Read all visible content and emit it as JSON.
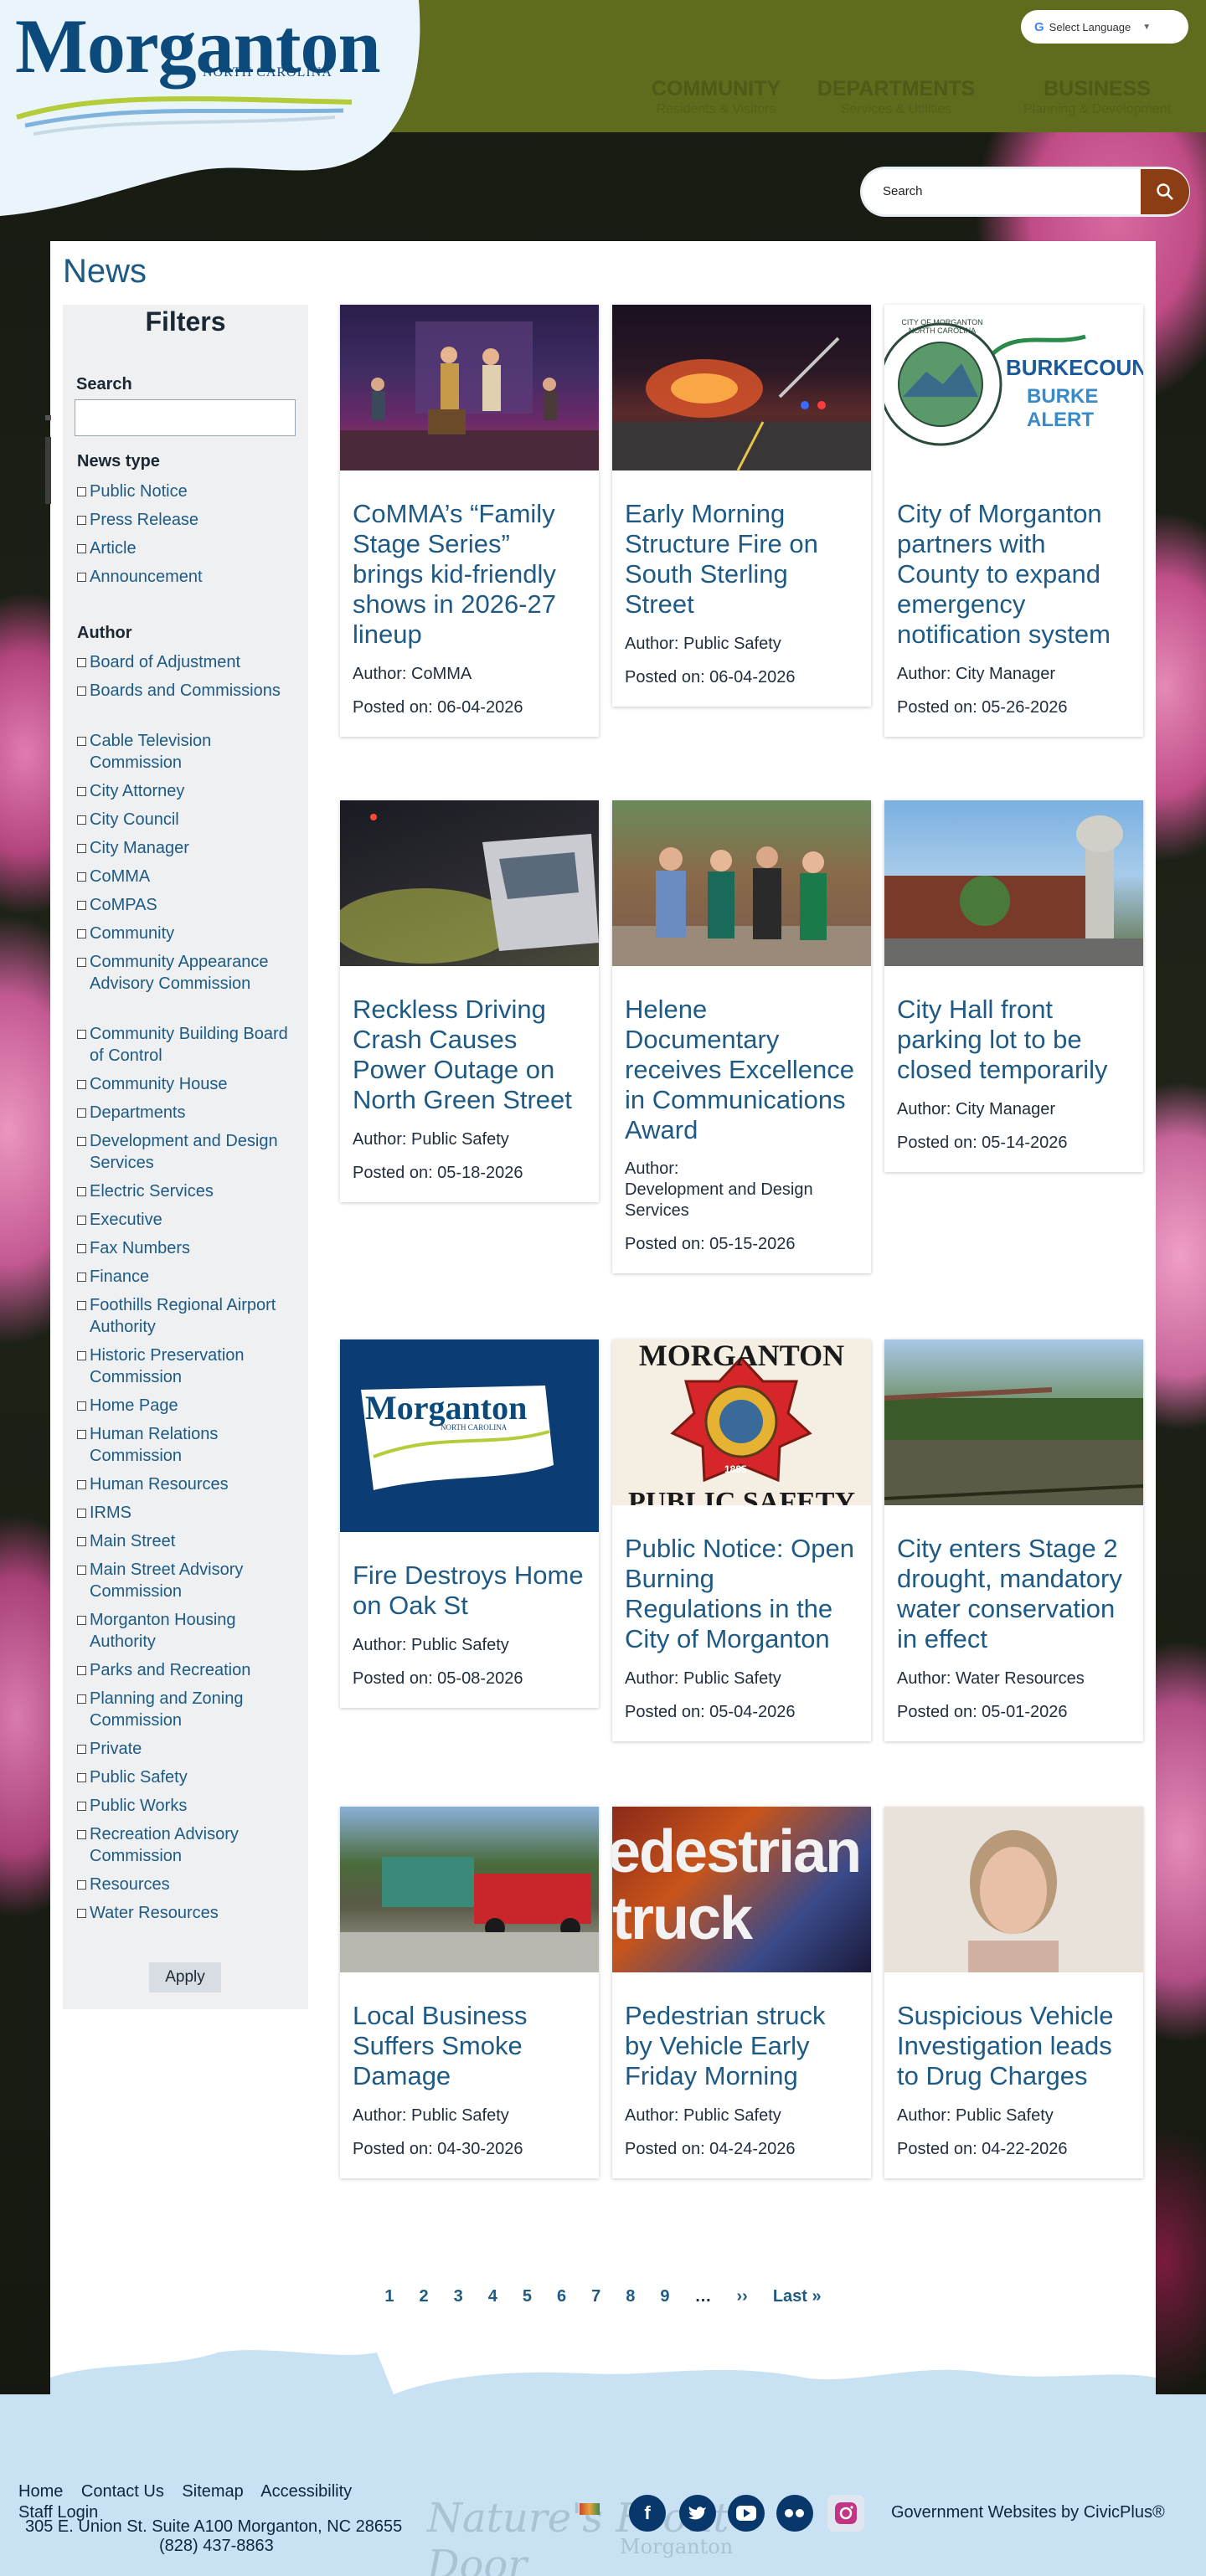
{
  "header": {
    "logo_title": "Morganton",
    "logo_subtitle": "NORTH CAROLINA",
    "language_label": "Select Language",
    "language_caret": "▼",
    "nav": [
      {
        "title": "COMMUNITY",
        "sub": "Residents & Visitors"
      },
      {
        "title": "DEPARTMENTS",
        "sub": "Services & Utilities"
      },
      {
        "title": "BUSINESS",
        "sub": "Planning & Development"
      }
    ],
    "search_placeholder": "Search"
  },
  "page": {
    "title": "News"
  },
  "filters": {
    "heading": "Filters",
    "search_label": "Search",
    "news_type_label": "News type",
    "news_types": [
      "Public Notice",
      "Press Release",
      "Article",
      "Announcement"
    ],
    "author_label": "Author",
    "authors": [
      "Board of Adjustment",
      "Boards and Commissions",
      "Cable Television Commission",
      "City Attorney",
      "City Council",
      "City Manager",
      "CoMMA",
      "CoMPAS",
      "Community",
      "Community Appearance Advisory Commission",
      "Community Building Board of Control",
      "Community House",
      "Departments",
      "Development and Design Services",
      "Electric Services",
      "Executive",
      "Fax Numbers",
      "Finance",
      "Foothills Regional Airport Authority",
      "Historic Preservation Commission",
      "Home Page",
      "Human Relations Commission",
      "Human Resources",
      "IRMS",
      "Main Street",
      "Main Street Advisory Commission",
      "Morganton Housing Authority",
      "Parks and Recreation",
      "Planning and Zoning Commission",
      "Private",
      "Public Safety",
      "Public Works",
      "Recreation Advisory Commission",
      "Resources",
      "Water Resources"
    ],
    "apply_label": "Apply"
  },
  "articles": [
    {
      "title": "CoMMA’s “Family Stage Series” brings kid-friendly shows in 2026-27 lineup",
      "author": "Author: CoMMA",
      "posted": "Posted on: 06-04-2026"
    },
    {
      "title": "Early Morning Structure Fire on South Sterling Street",
      "author": "Author: Public Safety",
      "posted": "Posted on: 06-04-2026"
    },
    {
      "title": "City of Morganton partners with County to expand emergency notification system",
      "author": "Author: City Manager",
      "posted": "Posted on: 05-26-2026"
    },
    {
      "title": "Reckless Driving Crash Causes Power Outage on North Green Street",
      "author": "Author: Public Safety",
      "posted": "Posted on: 05-18-2026"
    },
    {
      "title": "Helene Documentary receives Excellence in Communications Award",
      "author_prefix": "Author:",
      "author": "Development and Design Services",
      "posted": "Posted on: 05-15-2026"
    },
    {
      "title": "City Hall front parking lot to be closed temporarily",
      "author": "Author: City Manager",
      "posted": "Posted on: 05-14-2026"
    },
    {
      "title": "Fire Destroys Home on Oak St",
      "author": "Author: Public Safety",
      "posted": "Posted on: 05-08-2026"
    },
    {
      "title": "Public Notice: Open Burning Regulations in the City of Morganton",
      "author": "Author: Public Safety",
      "posted": "Posted on: 05-04-2026"
    },
    {
      "title": "City enters Stage 2 drought, mandatory water conservation in effect",
      "author": "Author: Water Resources",
      "posted": "Posted on: 05-01-2026"
    },
    {
      "title": "Local Business Suffers Smoke Damage",
      "author": "Author: Public Safety",
      "posted": "Posted on: 04-30-2026"
    },
    {
      "title": "Pedestrian struck by Vehicle Early Friday Morning",
      "author": "Author: Public Safety",
      "posted": "Posted on: 04-24-2026"
    },
    {
      "title": "Suspicious Vehicle Investigation leads to Drug Charges",
      "author": "Author: Public Safety",
      "posted": "Posted on: 04-22-2026"
    }
  ],
  "image_text": {
    "seal_ring": "CITY OF MORGANTON NORTH CAROLINA",
    "burke_county": "BURKECOUNTY",
    "burke_alert": "BURKE ALERT",
    "logo_card": "Morganton",
    "logo_card_sub": "NORTH CAROLINA",
    "ps_top": "MORGANTON",
    "ps_bottom": "PUBLIC SAFETY",
    "ps_year": "1885",
    "ped_line1": "edestrian",
    "ped_line2": "truck"
  },
  "pagination": [
    "1",
    "2",
    "3",
    "4",
    "5",
    "6",
    "7",
    "8",
    "9",
    "…",
    "››",
    "Last »"
  ],
  "footer": {
    "links": [
      "Home",
      "Contact Us",
      "Sitemap",
      "Accessibility"
    ],
    "staff_login": "Staff Login",
    "address": "305 E. Union St. Suite A100 Morganton, NC 28655",
    "phone": "(828) 437-8863",
    "nature_text": "Nature's Front Door",
    "nature_sub": "Morganton",
    "civicplus": "Government Websites by CivicPlus®",
    "social_icons": [
      "facebook-icon",
      "twitter-icon",
      "youtube-icon",
      "flickr-icon",
      "instagram-icon"
    ]
  },
  "colors": {
    "header_olive": "#5f6b1d",
    "link_blue": "#1e5a84",
    "brand_navy": "#0b4a7a",
    "search_button": "#8b3d14"
  }
}
